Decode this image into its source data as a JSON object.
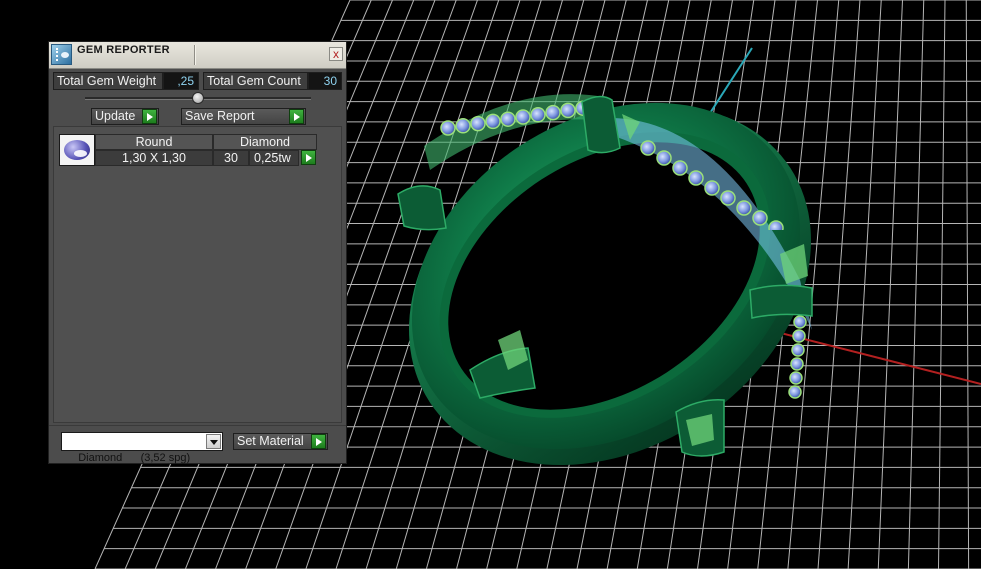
{
  "panel": {
    "title": "GEM REPORTER",
    "close_glyph": "x",
    "total_gem_weight_label": "Total Gem Weight",
    "total_gem_weight_value": ",25",
    "total_gem_count_label": "Total Gem Count",
    "total_gem_count_value": "30",
    "update_label": "Update",
    "save_report_label": "Save Report",
    "gem_list": {
      "headers": [
        "Round",
        "Diamond"
      ],
      "rows": [
        {
          "size": "1,30 X 1,30",
          "count": "30",
          "weight": "0,25tw"
        }
      ]
    },
    "material_select_value": "Diamond      (3,52 spg)",
    "set_material_label": "Set Material"
  },
  "icons": {
    "app": "gem-reporter-icon",
    "close": "close-icon",
    "go": "play-arrow-icon",
    "dropdown": "chevron-down-icon",
    "gem": "round-diamond-icon"
  },
  "colors": {
    "ring": "#0f7a4a",
    "stones": "#8ea6e6",
    "axis_x": "#b32020",
    "axis_y": "#2aa8b8",
    "grid": "#b8b8b8",
    "value_text": "#8fd3f0",
    "go_button": "#2e9a2e"
  }
}
